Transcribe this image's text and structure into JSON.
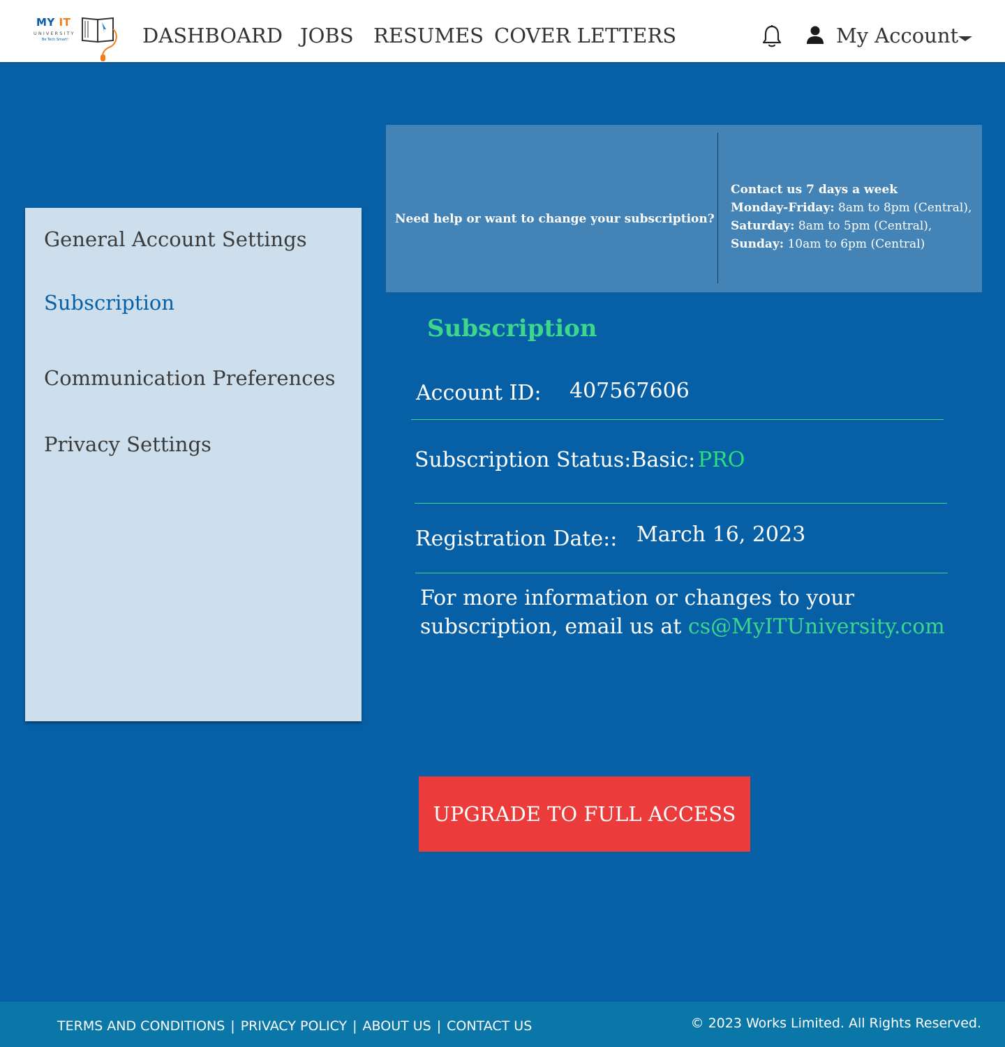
{
  "brand": {
    "logo_my": "MY",
    "logo_it": "IT",
    "logo_university": "UNIVERSITY",
    "logo_tagline": "Be Tech Smart!",
    "primary_color": "#0760a6",
    "accent_color": "#3dd68c",
    "button_color": "#eb3b3b"
  },
  "nav": {
    "dashboard": "DASHBOARD",
    "jobs": "JOBS",
    "resumes": "RESUMES",
    "cover_letters": "COVER LETTERS",
    "notifications_icon": "bell-icon",
    "user_icon": "user-icon",
    "account": "My Account"
  },
  "sidebar": {
    "items": [
      {
        "label": "General Account Settings",
        "active": false
      },
      {
        "label": "Subscription",
        "active": true
      },
      {
        "label": "Communication Preferences",
        "active": false
      },
      {
        "label": "Privacy Settings",
        "active": false
      }
    ]
  },
  "help": {
    "question": "Need help or want to change your subscription?",
    "contact_heading": "Contact us 7 days a week",
    "weekday_label": "Monday-Friday:",
    "weekday_hours": " 8am to 8pm (Central),",
    "saturday_label": "Saturday:",
    "saturday_hours": " 8am to 5pm (Central),",
    "sunday_label": "Sunday:",
    "sunday_hours": " 10am to 6pm (Central)"
  },
  "subscription": {
    "title": "Subscription",
    "account_id_label": "Account ID:",
    "account_id": "407567606",
    "status_label": "Subscription Status:Basic:",
    "status_value": "PRO",
    "registration_label": "Registration Date::",
    "registration_date": "March 16, 2023",
    "info_text": "For more information or changes to your subscription, email us at ",
    "email": "cs@MyITUniversity.com",
    "upgrade_button": "UPGRADE TO FULL ACCESS"
  },
  "footer": {
    "terms": "TERMS AND CONDITIONS",
    "privacy": "PRIVACY POLICY",
    "about": "ABOUT US",
    "contact": "CONTACT US",
    "separator": "|",
    "copyright": "© 2023 Works Limited. All Rights Reserved."
  }
}
